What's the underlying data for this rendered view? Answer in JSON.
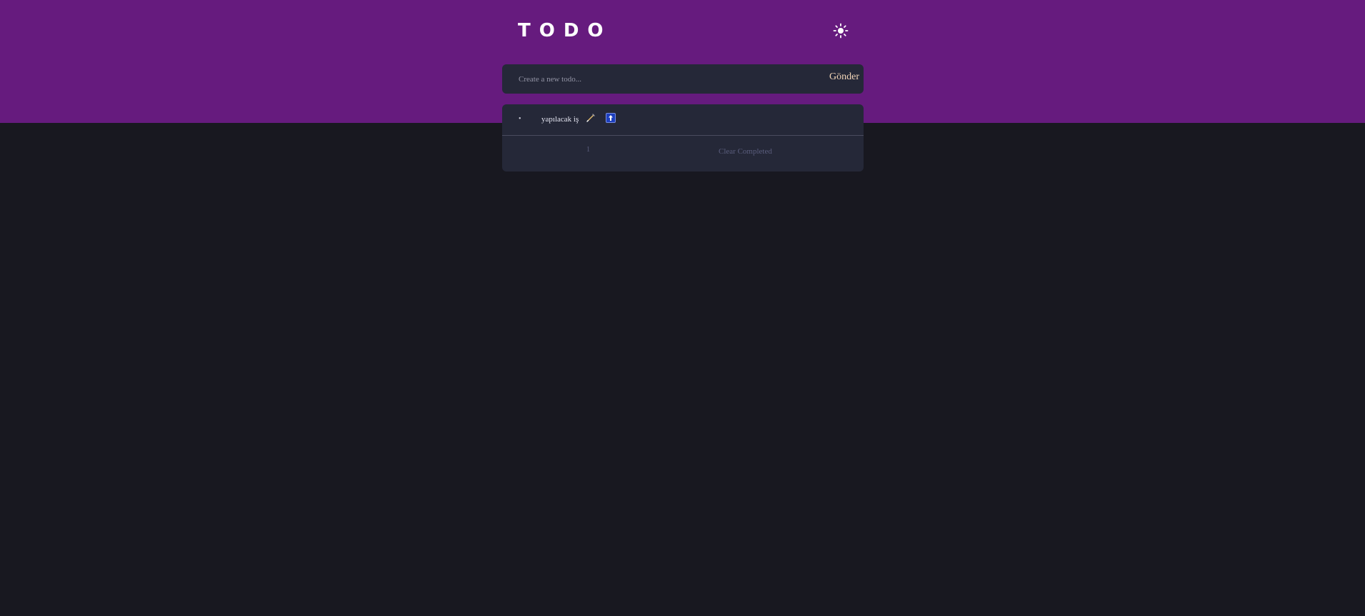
{
  "app": {
    "title": "TODO",
    "theme_icon": "sun-icon"
  },
  "colors": {
    "header_bg": "#661b7e",
    "page_bg": "#181820",
    "card_bg": "#252838",
    "submit_text": "#f3d6b8",
    "muted_text": "#5b5e7e"
  },
  "new_todo": {
    "placeholder": "Create a new todo...",
    "value": "",
    "submit_label": "Gönder"
  },
  "todos": [
    {
      "text": "yapılacak iş",
      "bullet": "•",
      "edit_icon": "pencil-icon",
      "share_icon": "arrow-up-icon"
    }
  ],
  "footer": {
    "count": "1",
    "clear_label": "Clear Completed"
  }
}
